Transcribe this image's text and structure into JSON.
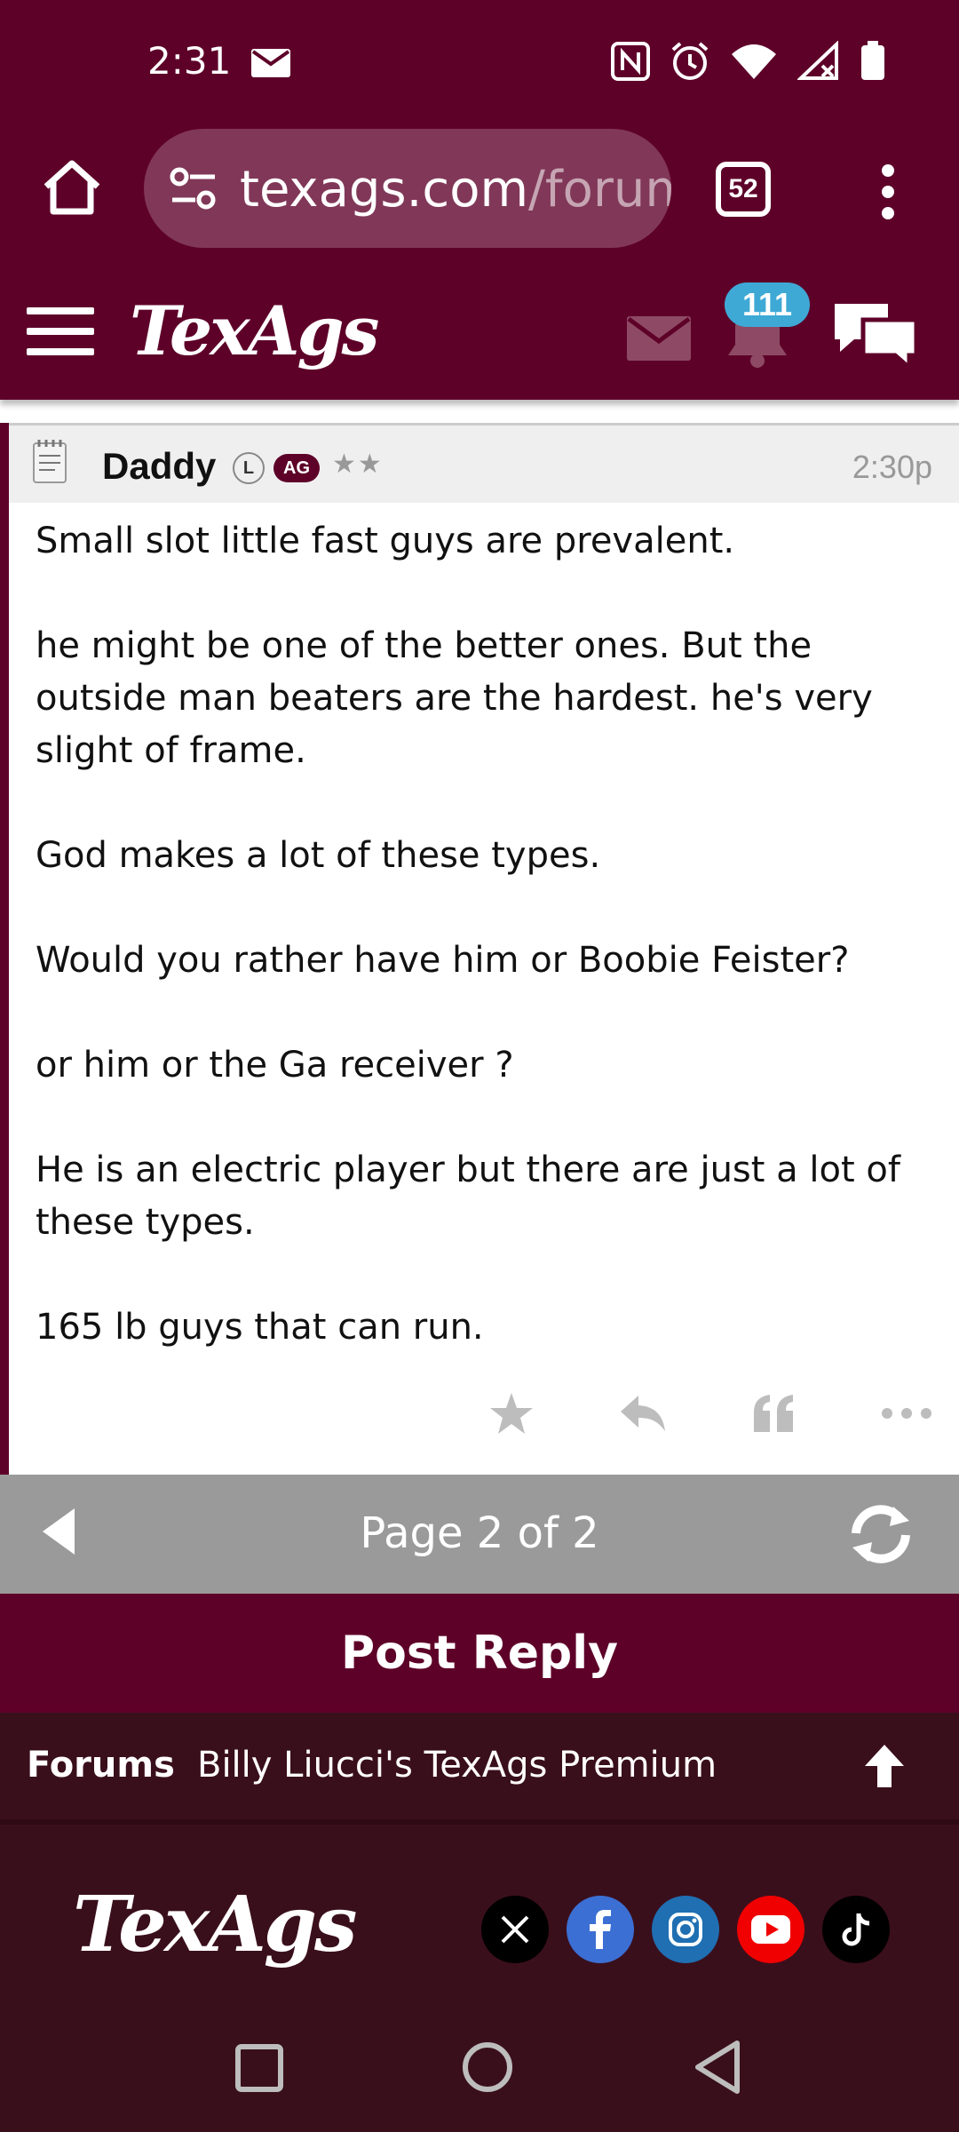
{
  "status_bar": {
    "time": "2:31"
  },
  "browser": {
    "url_host": "texags.com",
    "url_path": "/forum",
    "tab_count": "52"
  },
  "site_header": {
    "logo": "TexAgs",
    "notification_count": "111"
  },
  "post": {
    "author": "Daddy",
    "badge_l": "L",
    "badge_ag": "AG",
    "stars": "★★",
    "time": "2:30p",
    "paragraphs": [
      "Small slot little fast guys are prevalent.",
      "he might be one of the better ones. But the outside man beaters are the hardest. he's very slight of frame.",
      "God makes a lot of these types.",
      "Would you rather have him or Boobie Feister?",
      "or him or the Ga receiver ?",
      "He is an electric player but there are just a lot of these types.",
      "165 lb guys that can run."
    ]
  },
  "pager": {
    "text": "Page 2 of 2"
  },
  "post_reply": {
    "label": "Post Reply"
  },
  "breadcrumb": {
    "forums": "Forums",
    "board": "Billy Liucci's TexAgs Premium"
  },
  "footer": {
    "logo": "TexAgs"
  },
  "colors": {
    "maroon": "#5e0129",
    "dark_maroon": "#3a0f1c",
    "badge_blue": "#3fa9d6",
    "pager_gray": "#9a9a9a"
  }
}
